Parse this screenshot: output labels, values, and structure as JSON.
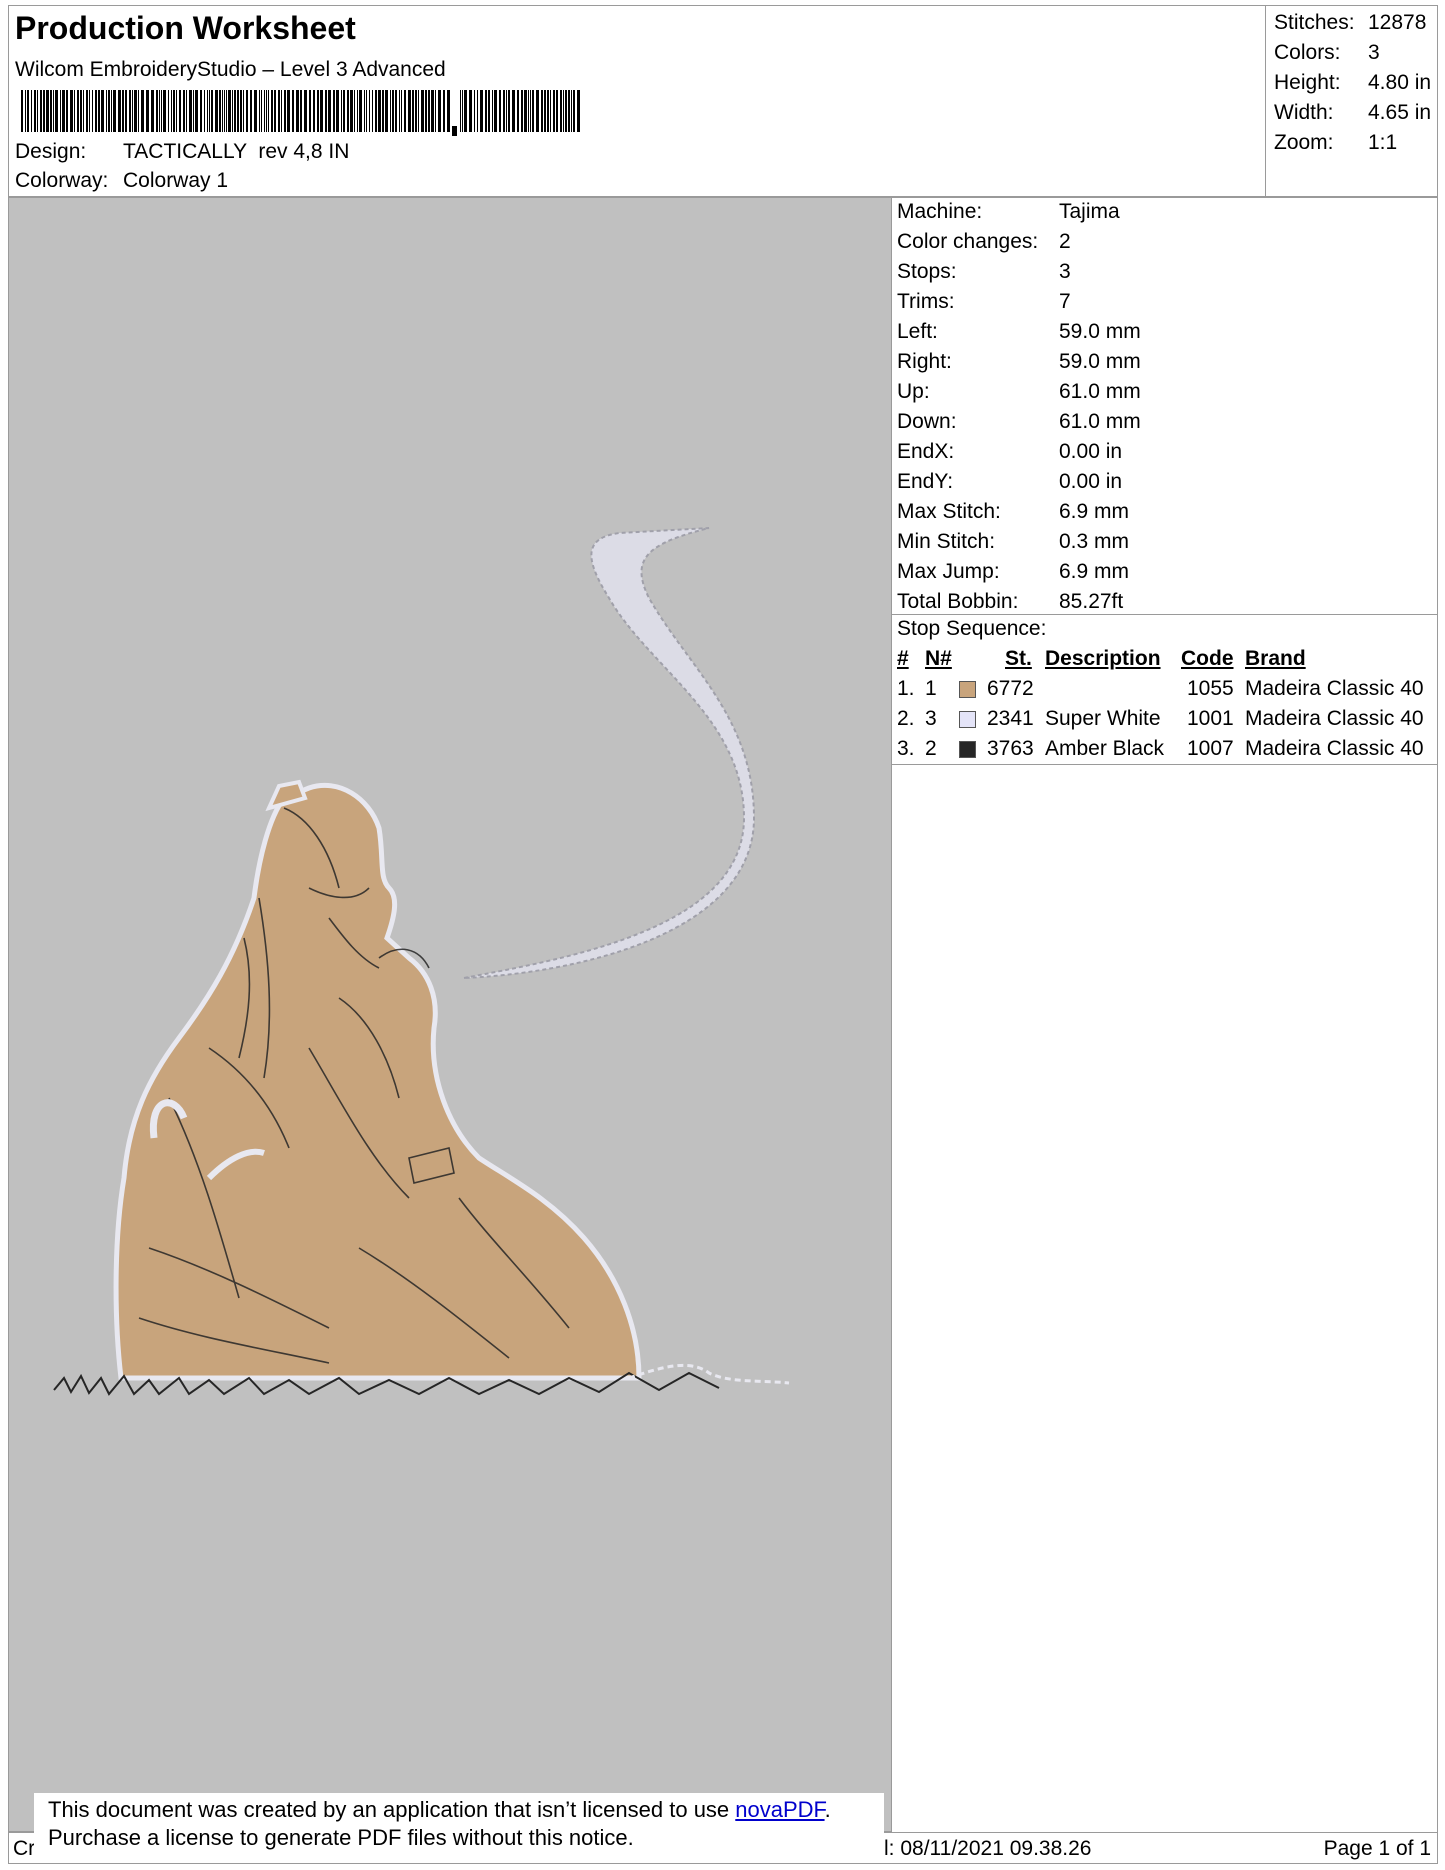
{
  "header": {
    "title": "Production Worksheet",
    "software": "Wilcom EmbroideryStudio – Level 3 Advanced",
    "design_label": "Design:",
    "design_value": "TACTICALLY  rev 4,8 IN",
    "colorway_label": "Colorway:",
    "colorway_value": "Colorway 1"
  },
  "stats": [
    {
      "label": "Stitches:",
      "value": "12878"
    },
    {
      "label": "Colors:",
      "value": "3"
    },
    {
      "label": "Height:",
      "value": "4.80 in"
    },
    {
      "label": "Width:",
      "value": "4.65 in"
    },
    {
      "label": "Zoom:",
      "value": "1:1"
    }
  ],
  "details": [
    {
      "label": "Machine:",
      "value": "Tajima"
    },
    {
      "label": "Color changes:",
      "value": "2"
    },
    {
      "label": "Stops:",
      "value": "3"
    },
    {
      "label": "Trims:",
      "value": "7"
    },
    {
      "label": "Left:",
      "value": "59.0 mm"
    },
    {
      "label": "Right:",
      "value": "59.0 mm"
    },
    {
      "label": "Up:",
      "value": "61.0 mm"
    },
    {
      "label": "Down:",
      "value": "61.0 mm"
    },
    {
      "label": "EndX:",
      "value": "0.00 in"
    },
    {
      "label": "EndY:",
      "value": "0.00 in"
    },
    {
      "label": "Max Stitch:",
      "value": "6.9 mm"
    },
    {
      "label": "Min Stitch:",
      "value": "0.3 mm"
    },
    {
      "label": "Max Jump:",
      "value": "6.9 mm"
    },
    {
      "label": "Total Bobbin:",
      "value": "85.27ft"
    }
  ],
  "stop_sequence": {
    "title": "Stop Sequence:",
    "headers": {
      "num": "#",
      "n": "N#",
      "st": "St.",
      "description": "Description",
      "code": "Code",
      "brand": "Brand"
    },
    "rows": [
      {
        "num": "1.",
        "n": "1",
        "color": "#c8a47c",
        "st": "6772",
        "description": "",
        "code": "1055",
        "brand": "Madeira Classic 40"
      },
      {
        "num": "2.",
        "n": "3",
        "color": "#e4e4f8",
        "st": "2341",
        "description": "Super White",
        "code": "1001",
        "brand": "Madeira Classic 40"
      },
      {
        "num": "3.",
        "n": "2",
        "color": "#262626",
        "st": "3763",
        "description": "Amber Black",
        "code": "1007",
        "brand": "Madeira Classic 40"
      }
    ]
  },
  "footer": {
    "left": "Cr",
    "date": "l: 08/11/2021 09.38.26",
    "page": "Page 1 of 1"
  },
  "notice": {
    "line1_prefix": "This document was created by an application that isn’t licensed to use ",
    "link": "novaPDF",
    "line1_suffix": ".",
    "line2": "Purchase a license to generate PDF files without this notice."
  },
  "colors": {
    "preview_background": "#c0c0c0",
    "fabric_tan": "#c8a47c",
    "thread_white": "#e4e4f8",
    "thread_black": "#262626"
  }
}
